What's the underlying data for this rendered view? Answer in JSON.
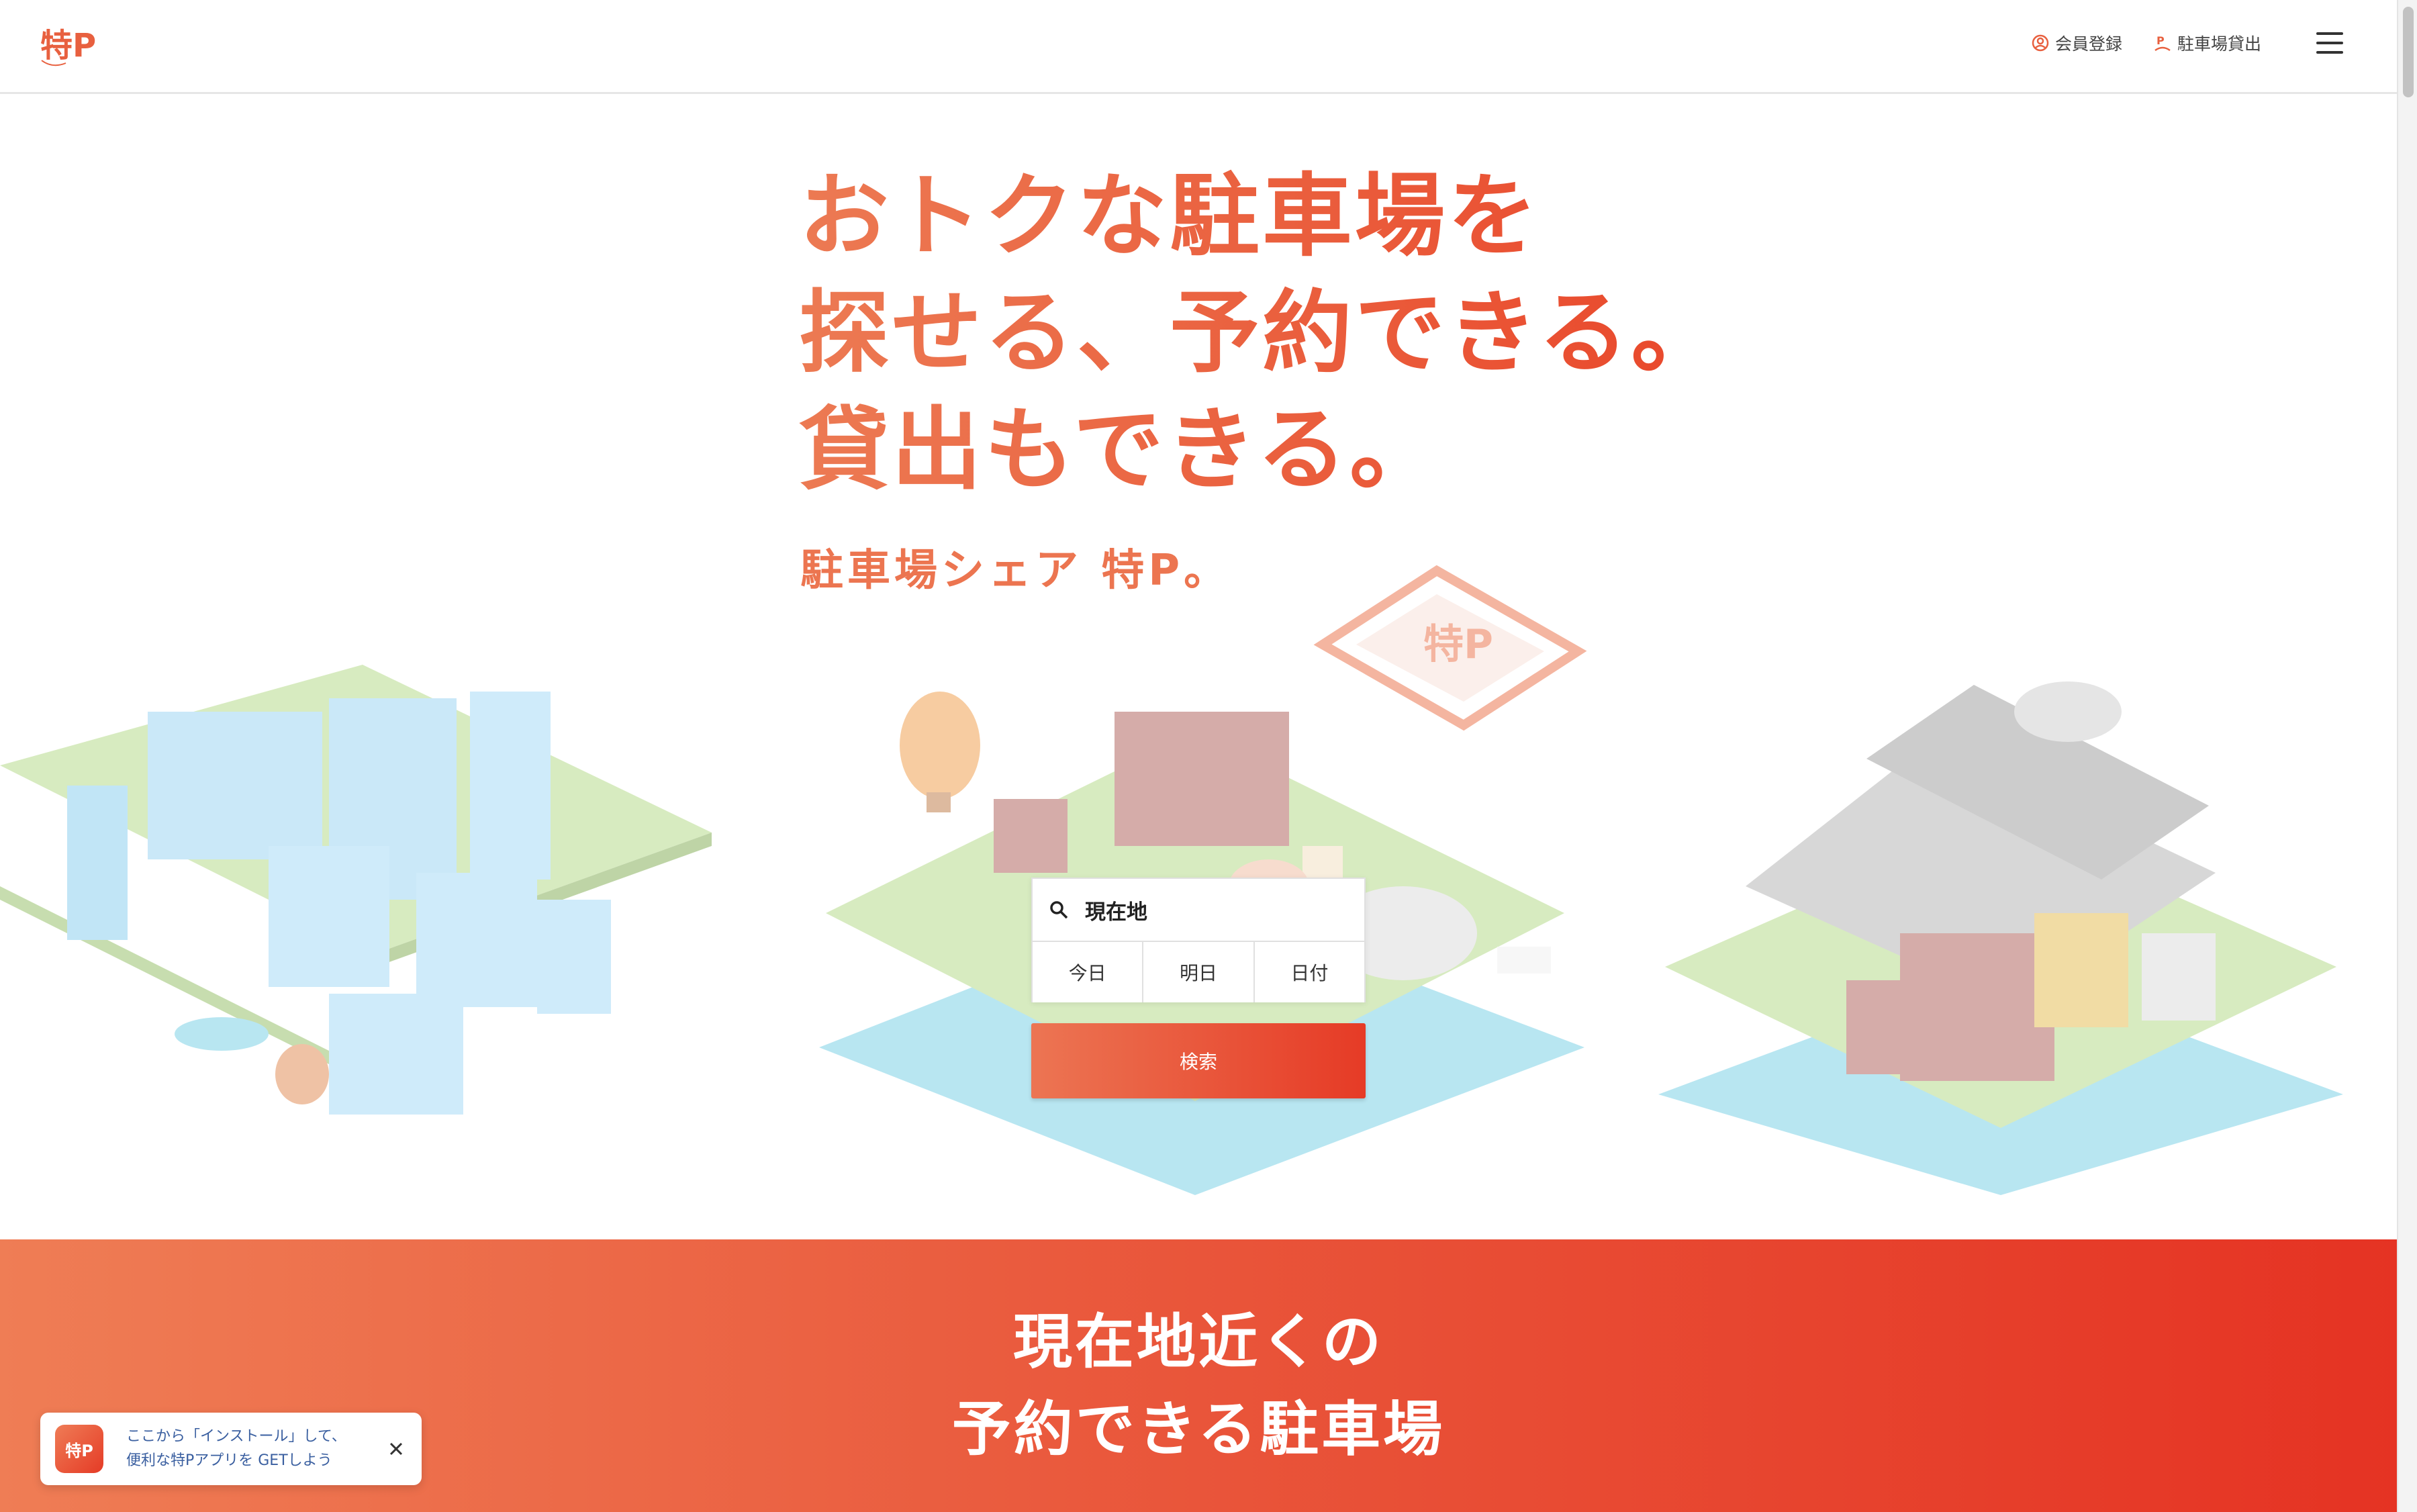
{
  "header": {
    "logo_text": "特P",
    "register_label": "会員登録",
    "lend_label": "駐車場貸出"
  },
  "hero": {
    "lines": [
      "おトクな駐車場を",
      "探せる、予約できる。",
      "貸出もできる。"
    ],
    "subtitle": "駐車場シェア 特P。"
  },
  "search": {
    "value": "現在地",
    "date_buttons": [
      "今日",
      "明日",
      "日付"
    ],
    "submit_label": "検索"
  },
  "nearby": {
    "title_lines": [
      "現在地近くの",
      "予約できる駐車場"
    ]
  },
  "app_banner": {
    "icon_text": "特P",
    "line1": "ここから「インストール」して、",
    "line2": "便利な特Pアプリを GETしよう"
  },
  "colors": {
    "accent": "#E94A2D",
    "accent_light": "#EC7A53",
    "link_blue": "#3A5FA0"
  },
  "icons": {
    "register": "user-circle-icon",
    "lend": "parking-person-icon",
    "menu": "hamburger-menu-icon",
    "search": "search-icon",
    "close": "close-icon"
  }
}
